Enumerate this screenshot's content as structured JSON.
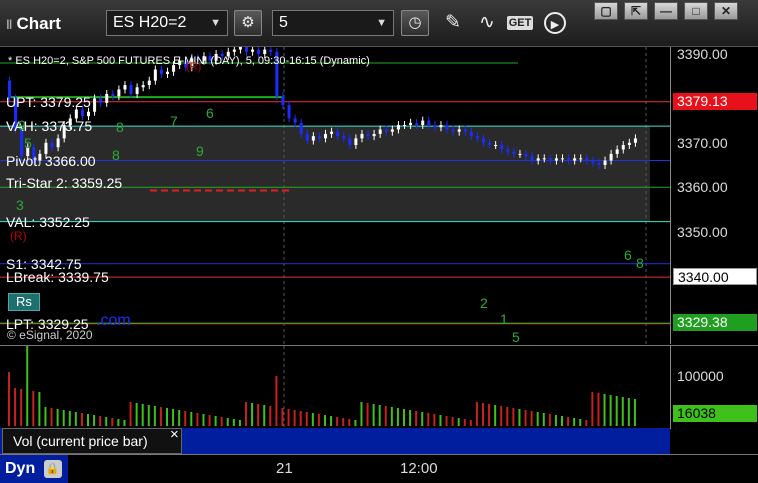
{
  "window": {
    "title": "Chart",
    "grip": "‖"
  },
  "toolbar": {
    "symbol": "ES H20=2",
    "interval": "5",
    "combo_arrow": "▼",
    "gear_glyph": "⚙",
    "clock_glyph": "◷",
    "pencil_glyph": "✎",
    "study_glyph": "∿",
    "get_label": "GET",
    "play_glyph": "▶"
  },
  "window_buttons": {
    "restore": "▢",
    "popout": "⇱",
    "minimize": "—",
    "maximize": "□",
    "close": "✕"
  },
  "chart": {
    "description": "* ES H20=2, S&P 500 FUTURES E-MINI (DAY), 5, 09:30-16:15 (Dynamic)",
    "watermark": "© eSignal, 2020",
    "watermark_url": ".com",
    "levels": [
      {
        "label": "UPT: 3379.25",
        "value": 3379.25,
        "color": "#e8333f"
      },
      {
        "label": "VAH: 3373.75",
        "value": 3373.75,
        "color": "#40e0d0"
      },
      {
        "label": "Pivot: 3366.00",
        "value": 3366.0,
        "color": "#2233dd"
      },
      {
        "label": "Tri-Star 2: 3359.25",
        "value": 3359.25,
        "color": "#e02020"
      },
      {
        "label": "VAL: 3352.25",
        "value": 3352.25,
        "color": "#40e0d0"
      },
      {
        "label": "S1: 3342.75",
        "value": 3342.75,
        "color": "#2233dd"
      },
      {
        "label": "LBreak: 3339.75",
        "value": 3339.75,
        "color": "#e03030"
      },
      {
        "label": "LPT: 3329.25",
        "value": 3329.25,
        "color": "#e8333f"
      }
    ],
    "extra_lines": [
      {
        "value": 3360.0,
        "color": "#22aa22"
      },
      {
        "value": 3329.38,
        "color": "#22aa22"
      }
    ],
    "rs_label": "Rs",
    "td_markers": [
      "9",
      "8",
      "7",
      "6",
      "9",
      "8",
      "5",
      "3",
      "2",
      "1",
      "5",
      "6",
      "8"
    ],
    "tag_r": "(R)"
  },
  "axis": {
    "ticks": [
      "3390.00",
      "3380.00",
      "3370.00",
      "3360.00",
      "3350.00",
      "3340.00"
    ],
    "tick_values": [
      3390,
      3380,
      3370,
      3360,
      3350,
      3340
    ],
    "upt_box": {
      "label": "3379.13",
      "bg": "#e8101a",
      "fg": "#ffffff"
    },
    "last_box": {
      "label": "3340.00",
      "bg": "#ffffff",
      "fg": "#000000"
    },
    "lpt_box": {
      "label": "3329.38",
      "bg": "#1f9e1f",
      "fg": "#ffffff"
    }
  },
  "volume": {
    "tick": "100000",
    "value_box": "16038",
    "label": "Vol (current price bar)",
    "close_glyph": "×"
  },
  "time_axis": {
    "mode": "Dyn",
    "labels": [
      {
        "text": "21"
      },
      {
        "text": "12:00"
      }
    ]
  },
  "colors": {
    "up": "#ffffff",
    "down": "#1a2cff",
    "panel_blue": "#001e9e"
  }
}
